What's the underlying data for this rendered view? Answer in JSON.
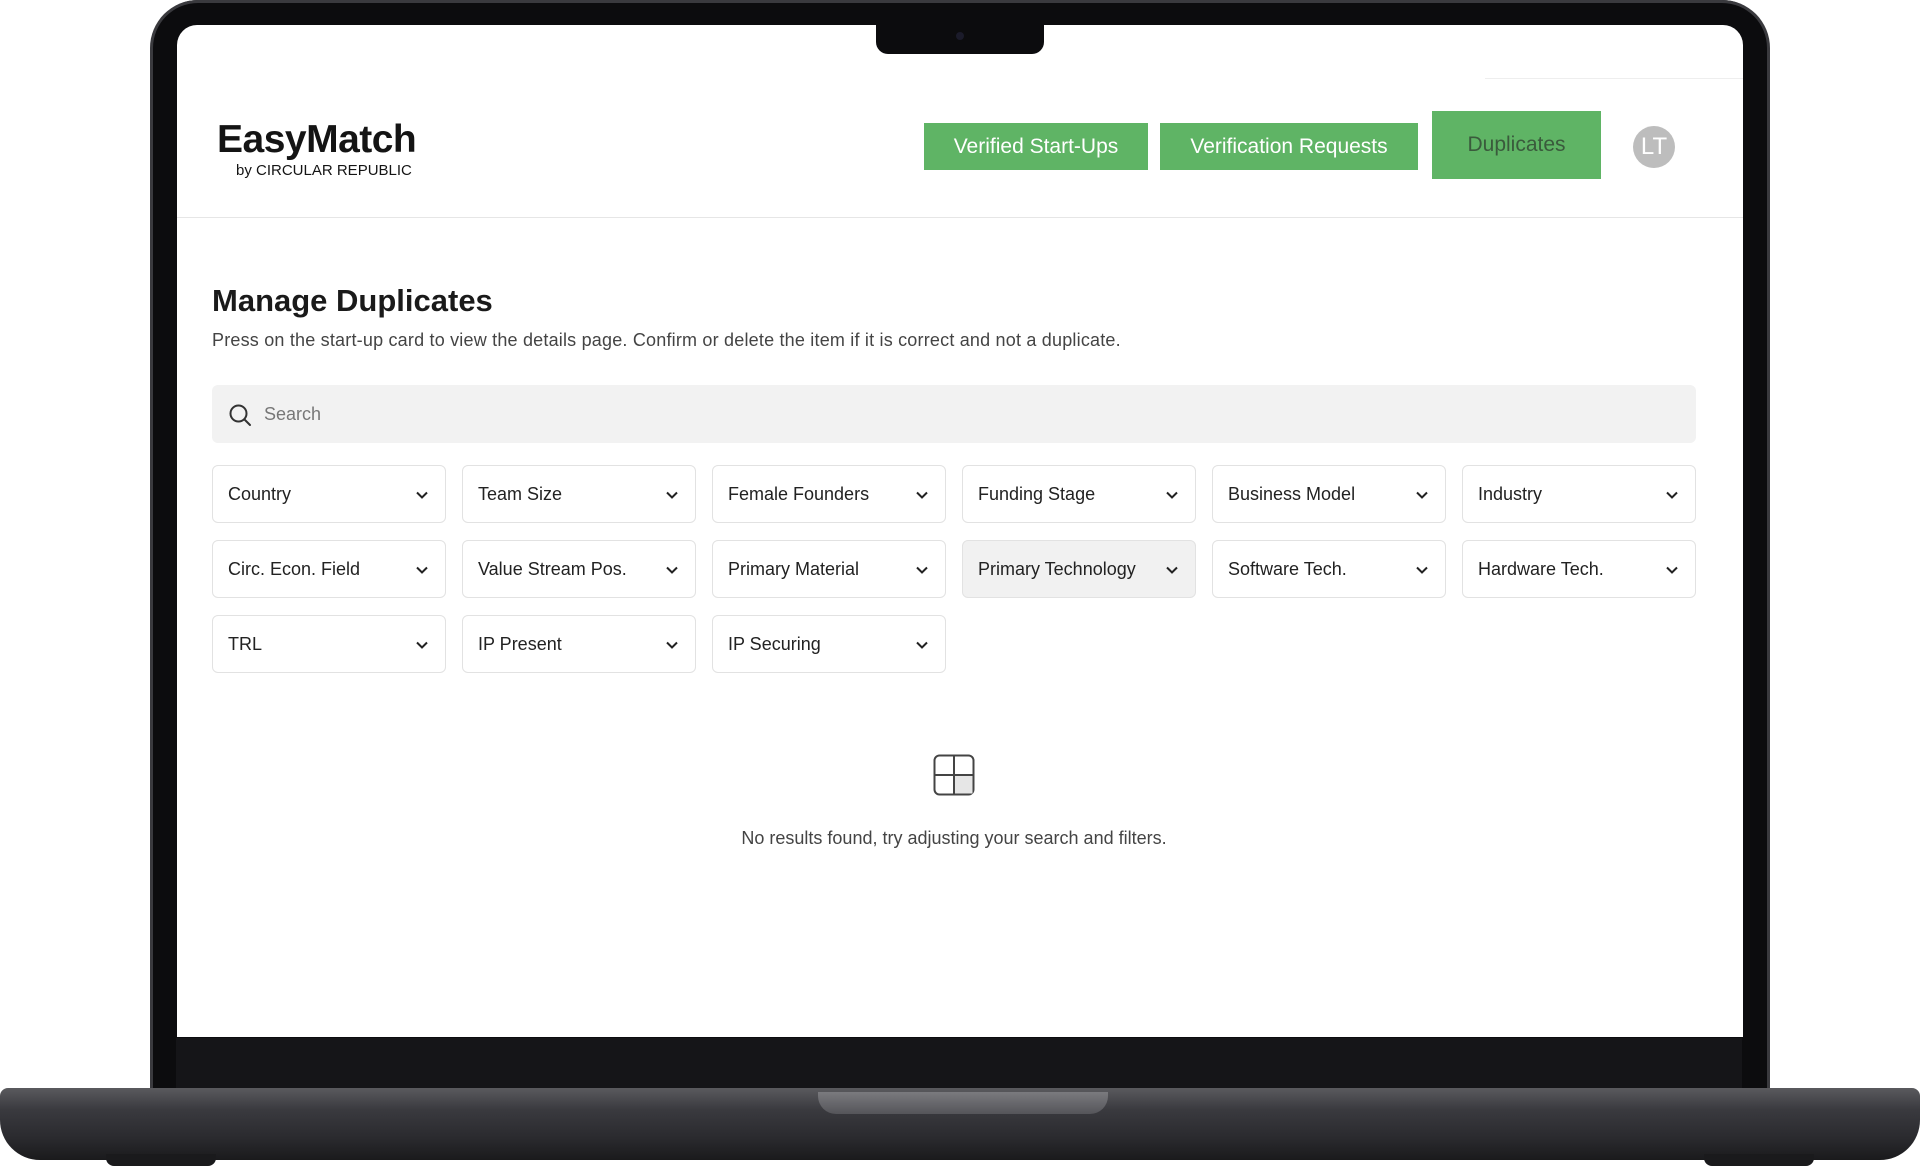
{
  "brand": {
    "name": "EasyMatch",
    "tagline": "by CIRCULAR REPUBLIC"
  },
  "nav": {
    "verified": "Verified Start-Ups",
    "requests": "Verification Requests",
    "duplicates": "Duplicates",
    "avatar_initials": "LT"
  },
  "page": {
    "title": "Manage Duplicates",
    "description": "Press on the start-up card to view the details page. Confirm or delete the item if it is correct and not a duplicate."
  },
  "search": {
    "placeholder": "Search",
    "value": ""
  },
  "filters": [
    {
      "label": "Country"
    },
    {
      "label": "Team Size"
    },
    {
      "label": "Female Founders"
    },
    {
      "label": "Funding Stage"
    },
    {
      "label": "Business Model"
    },
    {
      "label": "Industry"
    },
    {
      "label": "Circ. Econ. Field"
    },
    {
      "label": "Value Stream Pos."
    },
    {
      "label": "Primary Material"
    },
    {
      "label": "Primary Technology"
    },
    {
      "label": "Software Tech."
    },
    {
      "label": "Hardware Tech."
    },
    {
      "label": "TRL"
    },
    {
      "label": "IP Present"
    },
    {
      "label": "IP Securing"
    }
  ],
  "empty_state": {
    "icon": "grid-icon",
    "message": "No results found, try adjusting your search and filters."
  },
  "colors": {
    "accent": "#5fb465",
    "avatar": "#bdbdbd",
    "search_bg": "#f2f2f2"
  }
}
